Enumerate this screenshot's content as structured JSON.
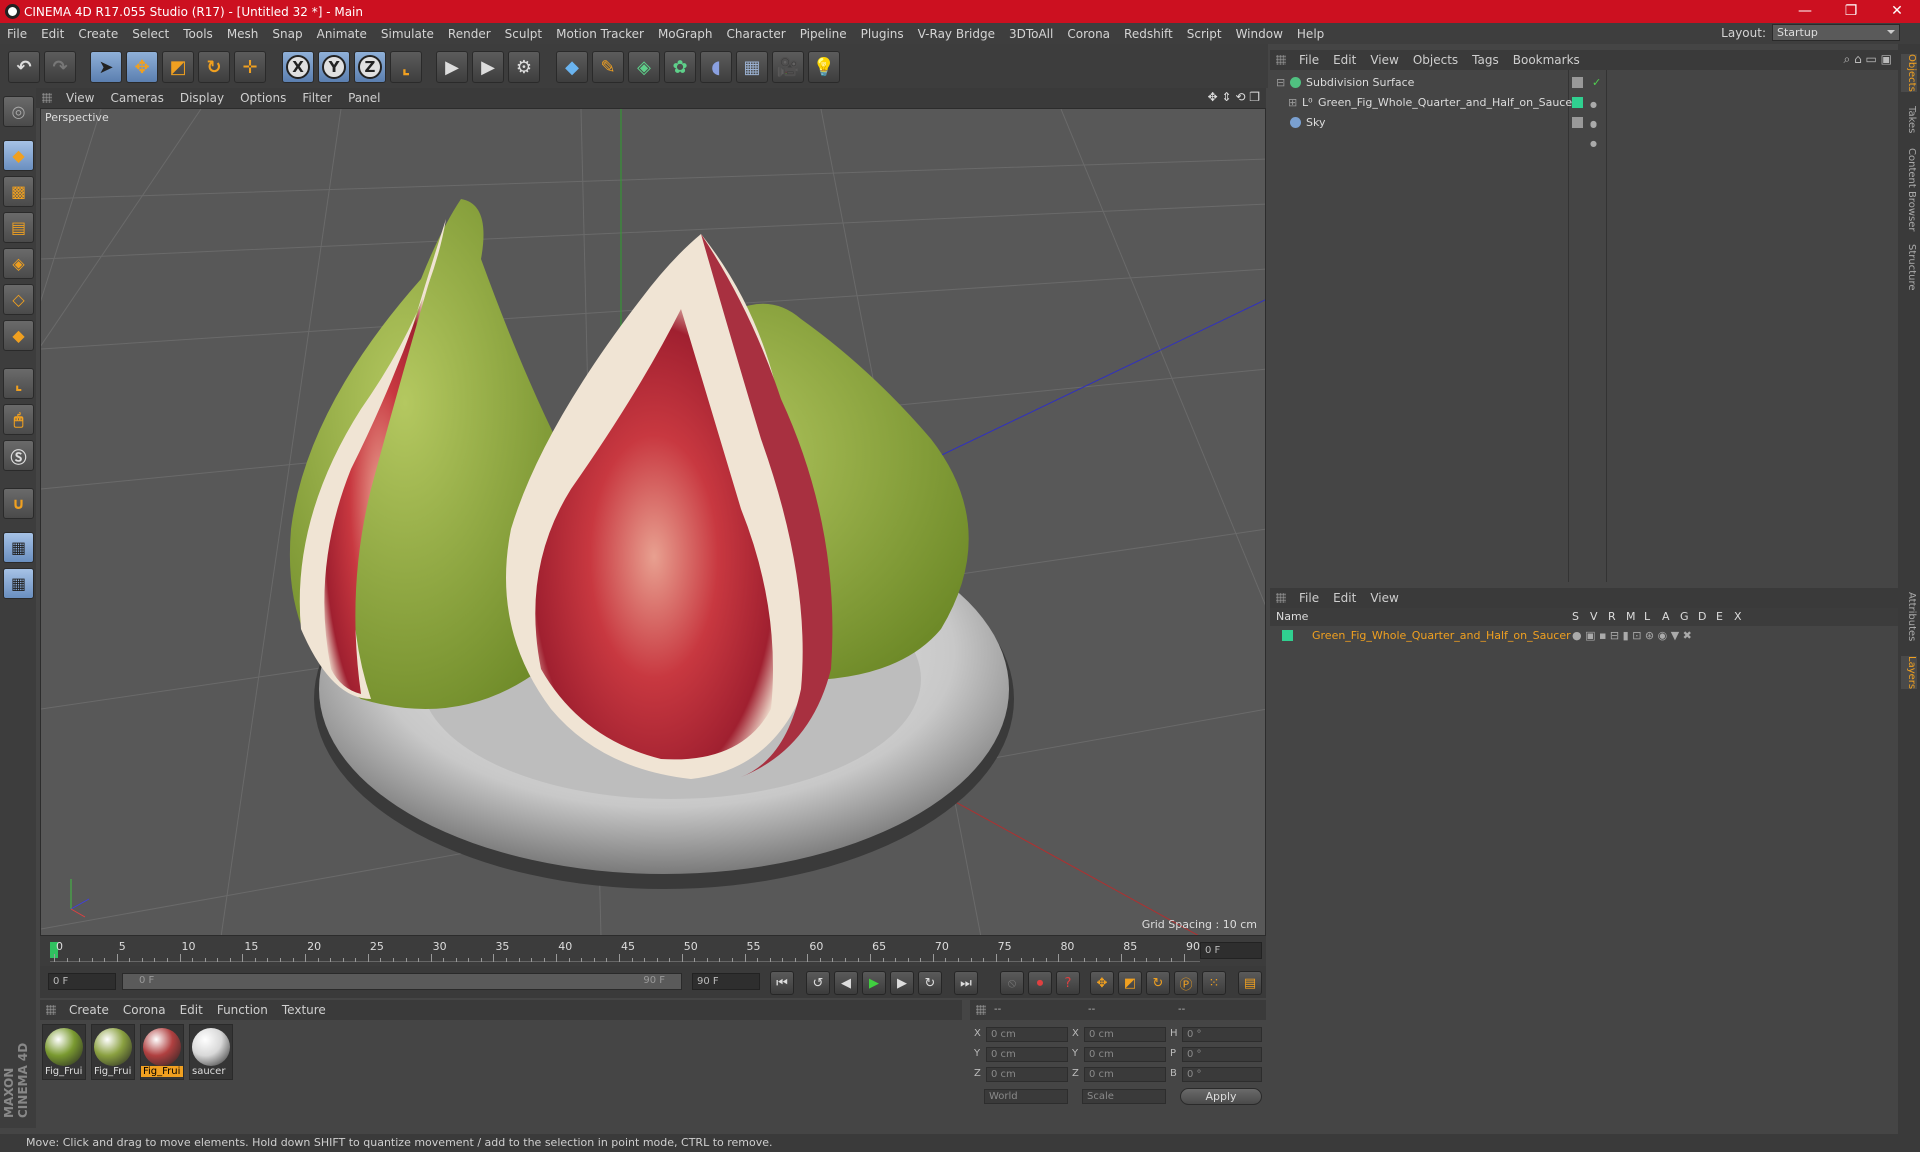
{
  "window": {
    "title": "CINEMA 4D R17.055 Studio (R17) - [Untitled 32 *] - Main"
  },
  "menu": [
    "File",
    "Edit",
    "Create",
    "Select",
    "Tools",
    "Mesh",
    "Snap",
    "Animate",
    "Simulate",
    "Render",
    "Sculpt",
    "Motion Tracker",
    "MoGraph",
    "Character",
    "Pipeline",
    "Plugins",
    "V-Ray Bridge",
    "3DToAll",
    "Corona",
    "Redshift",
    "Script",
    "Window",
    "Help"
  ],
  "layout": {
    "label": "Layout:",
    "value": "Startup"
  },
  "viewport": {
    "menu": [
      "View",
      "Cameras",
      "Display",
      "Options",
      "Filter",
      "Panel"
    ],
    "label": "Perspective",
    "grid_spacing": "Grid Spacing : 10 cm"
  },
  "timeline": {
    "ticks": [
      "0",
      "5",
      "10",
      "15",
      "20",
      "25",
      "30",
      "35",
      "40",
      "45",
      "50",
      "55",
      "60",
      "65",
      "70",
      "75",
      "80",
      "85",
      "90"
    ],
    "current_frame": "0 F",
    "start_field": "0 F",
    "range_start": "0 F",
    "range_end": "90 F",
    "end_field": "90 F"
  },
  "materials": {
    "menu": [
      "Create",
      "Corona",
      "Edit",
      "Function",
      "Texture"
    ],
    "items": [
      {
        "label": "Fig_Frui",
        "color": "#7a9a30"
      },
      {
        "label": "Fig_Frui",
        "color": "#8aa040"
      },
      {
        "label": "Fig_Frui",
        "color": "#b04040"
      },
      {
        "label": "saucer",
        "color": "#d8d8d8"
      }
    ]
  },
  "coords": {
    "head": [
      "--",
      "--",
      "--"
    ],
    "rows": [
      {
        "a": "X",
        "av": "0 cm",
        "b": "X",
        "bv": "0 cm",
        "c": "H",
        "cv": "0 °"
      },
      {
        "a": "Y",
        "av": "0 cm",
        "b": "Y",
        "bv": "0 cm",
        "c": "P",
        "cv": "0 °"
      },
      {
        "a": "Z",
        "av": "0 cm",
        "b": "Z",
        "bv": "0 cm",
        "c": "B",
        "cv": "0 °"
      }
    ],
    "world": "World",
    "scale": "Scale",
    "apply": "Apply"
  },
  "objects": {
    "menu": [
      "File",
      "Edit",
      "View",
      "Objects",
      "Tags",
      "Bookmarks"
    ],
    "items": [
      "Subdivision Surface",
      "Green_Fig_Whole_Quarter_and_Half_on_Saucer",
      "Sky"
    ]
  },
  "layers": {
    "menu": [
      "File",
      "Edit",
      "View"
    ],
    "columns": [
      "Name",
      "S",
      "V",
      "R",
      "M",
      "L",
      "A",
      "G",
      "D",
      "E",
      "X"
    ],
    "items": [
      "Green_Fig_Whole_Quarter_and_Half_on_Saucer"
    ],
    "color": "#f0a020"
  },
  "right_tabs": [
    "Objects",
    "Takes",
    "Content Browser",
    "Structure",
    "Attributes",
    "Layers"
  ],
  "status": "Move: Click and drag to move elements. Hold down SHIFT to quantize movement / add to the selection in point mode, CTRL to remove.",
  "brand": "MAXON CINEMA 4D"
}
